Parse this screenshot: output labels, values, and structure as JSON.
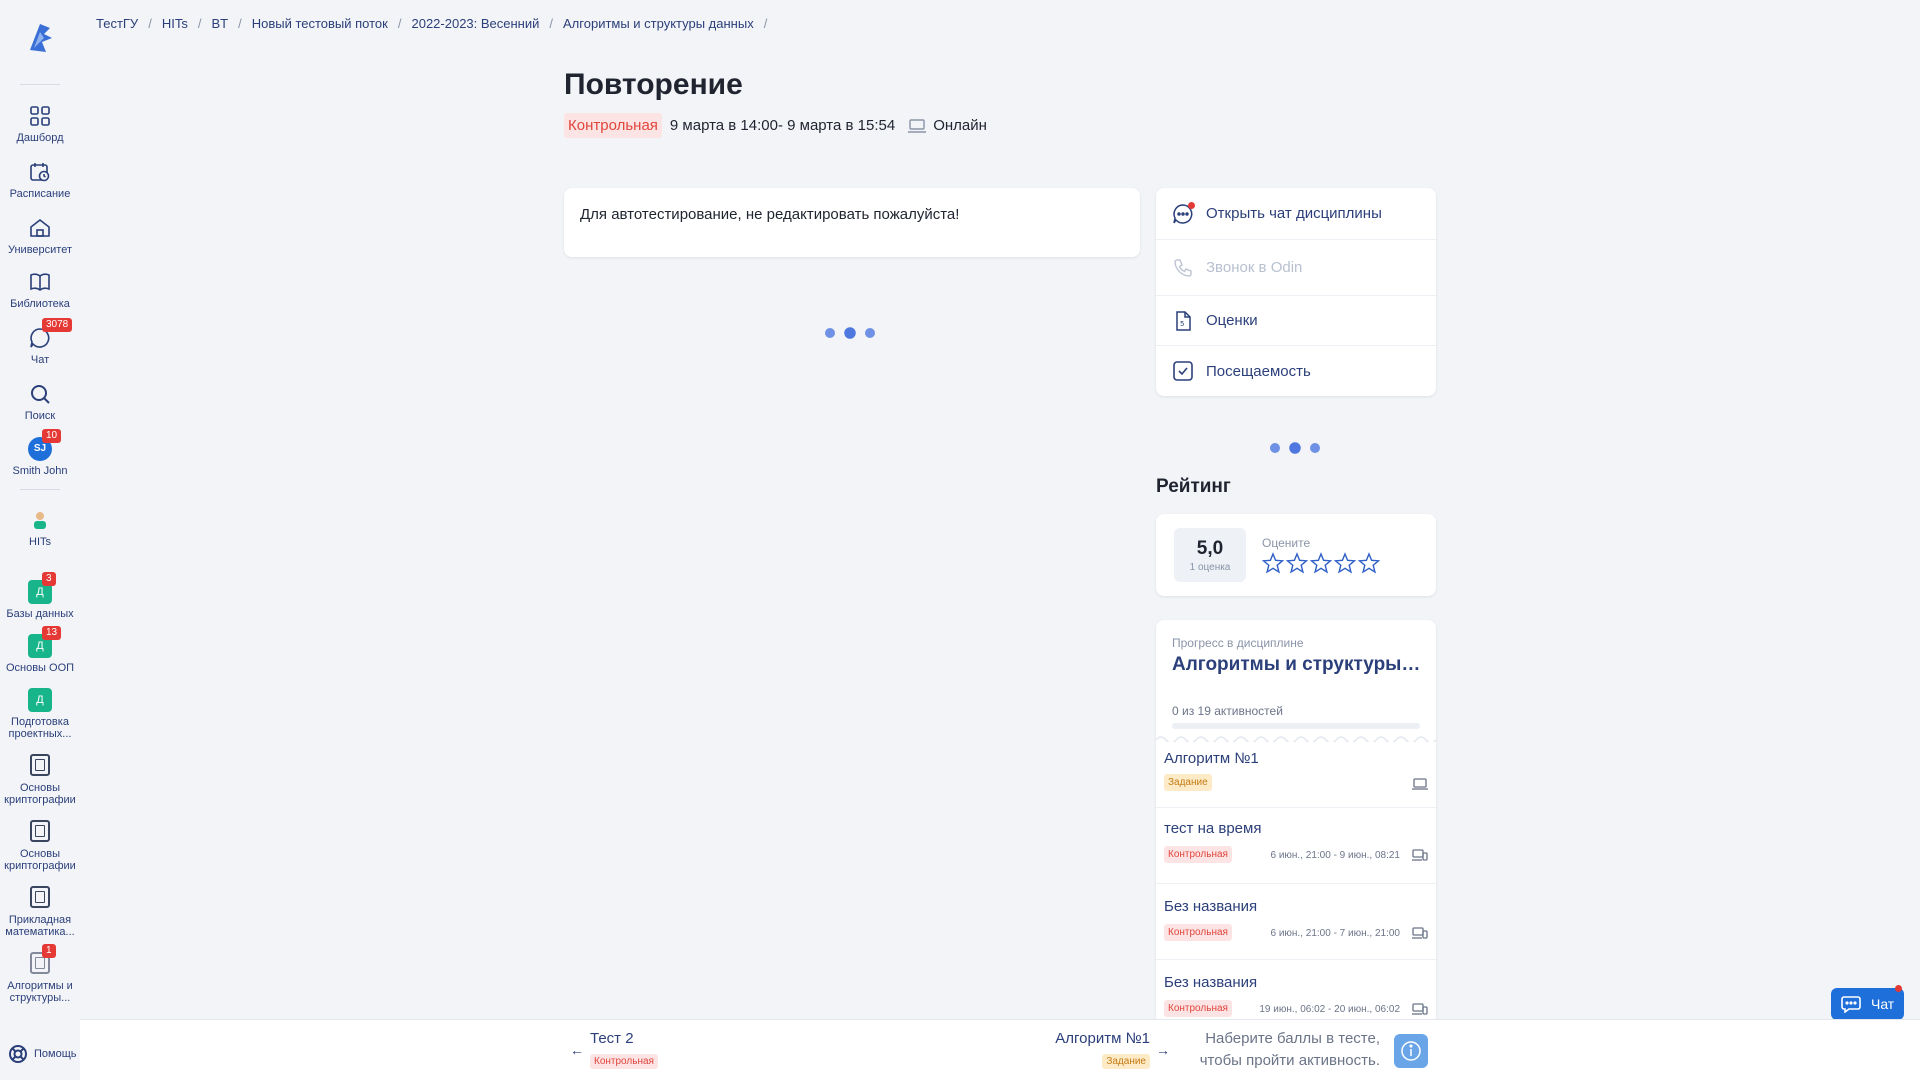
{
  "breadcrumb": [
    "ТестГУ",
    "HITs",
    "BT",
    "Новый тестовый поток",
    "2022-2023: Весенний",
    "Алгоритмы и структуры данных"
  ],
  "sidebar": {
    "items": [
      {
        "label": "Дашборд",
        "icon": "dashboard-icon"
      },
      {
        "label": "Расписание",
        "icon": "schedule-icon"
      },
      {
        "label": "Университет",
        "icon": "university-icon"
      },
      {
        "label": "Библиотека",
        "icon": "library-icon"
      },
      {
        "label": "Чат",
        "icon": "chat-icon",
        "badge": "3078"
      },
      {
        "label": "Поиск",
        "icon": "search-icon"
      },
      {
        "label": "Smith John",
        "avatar": "SJ",
        "badge": "10"
      }
    ],
    "groups": [
      {
        "label": "HITs"
      },
      {
        "label": "Базы данных",
        "avatar": "Д",
        "badge": "3"
      },
      {
        "label": "Основы ООП",
        "avatar": "Д",
        "badge": "13"
      },
      {
        "label": "Подготовка проектных...",
        "avatar": "Д"
      },
      {
        "label": "Основы криптографии"
      },
      {
        "label": "Основы криптографии"
      },
      {
        "label": "Прикладная математика..."
      },
      {
        "label": "Алгоритмы и структуры...",
        "badge": "1"
      }
    ],
    "help": "Помощь"
  },
  "page": {
    "title": "Повторение",
    "type_tag": "Контрольная",
    "dates": "9 марта в 14:00- 9 марта в 15:54",
    "mode": "Онлайн",
    "description": "Для автотестирование, не редактировать пожалуйста!"
  },
  "actions": [
    {
      "label": "Открыть чат дисциплины",
      "icon": "chat-icon"
    },
    {
      "label": "Звонок в Odin",
      "icon": "phone-icon"
    },
    {
      "label": "Оценки",
      "icon": "grades-icon"
    },
    {
      "label": "Посещаемость",
      "icon": "attendance-icon"
    }
  ],
  "rating": {
    "heading": "Рейтинг",
    "value": "5,0",
    "count": "1 оценка",
    "rate_label": "Оцените",
    "stars": 5
  },
  "progress": {
    "label": "Прогресс в дисциплине",
    "title": "Алгоритмы и структуры данных",
    "count": "0 из 19 активностей",
    "fraction": 0,
    "items": [
      {
        "name": "Алгоритм №1",
        "tag": "Задание",
        "tag_type": "yellow",
        "date": ""
      },
      {
        "name": "тест на время",
        "tag": "Контрольная",
        "tag_type": "red",
        "date": "6 июн., 21:00 - 9 июн., 08:21"
      },
      {
        "name": "Без названия",
        "tag": "Контрольная",
        "tag_type": "red",
        "date": "6 июн., 21:00 - 7 июн., 21:00"
      },
      {
        "name": "Без названия",
        "tag": "Контрольная",
        "tag_type": "red",
        "date": "19 июн., 06:02 - 20 июн., 06:02"
      }
    ]
  },
  "bottom": {
    "prev_title": "Тест 2",
    "prev_tag": "Контрольная",
    "next_title": "Алгоритм №1",
    "next_tag": "Задание",
    "hint_line1": "Наберите баллы в тесте,",
    "hint_line2": "чтобы пройти активность."
  },
  "chat_button": "Чат",
  "colors": {
    "accent": "#2b3f7a",
    "primary": "#1e6fd9",
    "danger": "#e53935",
    "success": "#19b58a"
  }
}
